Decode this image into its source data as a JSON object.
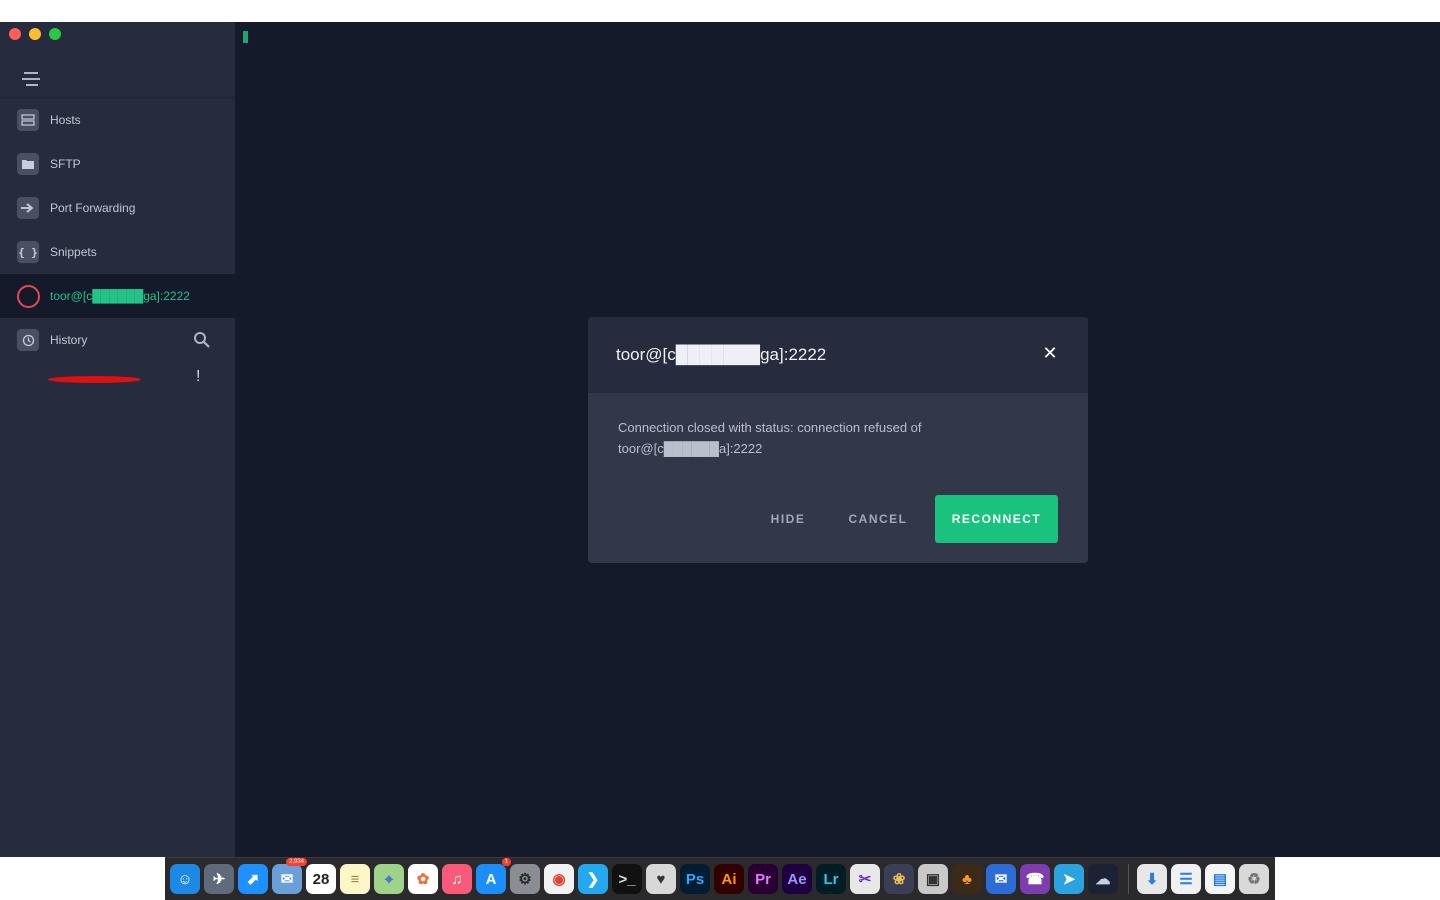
{
  "sidebar": {
    "items": [
      {
        "label": "Hosts",
        "icon": "hosts-icon"
      },
      {
        "label": "SFTP",
        "icon": "folder-icon"
      },
      {
        "label": "Port Forwarding",
        "icon": "port-forwarding-icon"
      },
      {
        "label": "Snippets",
        "icon": "snippets-icon"
      }
    ],
    "active_session": {
      "label": "toor@[c██████ga]:2222",
      "status_color": "#e5484d",
      "label_color": "#23c387"
    },
    "history": {
      "label": "History",
      "item_alert": "!"
    }
  },
  "modal": {
    "title": "toor@[c███████ga]:2222",
    "message_line1": "Connection closed with status: connection refused of",
    "message_line2": "toor@[c██████a]:2222",
    "hide_label": "HIDE",
    "cancel_label": "CANCEL",
    "reconnect_label": "RECONNECT",
    "accent_color": "#19c37d"
  },
  "dock": {
    "apps": [
      {
        "name": "finder-icon",
        "glyph": "☺",
        "bg": "#1e88e5",
        "fg": "#ffffff"
      },
      {
        "name": "launchpad-icon",
        "glyph": "✈",
        "bg": "#5f6b7a",
        "fg": "#ffffff"
      },
      {
        "name": "safari-icon",
        "glyph": "⬈",
        "bg": "#1e90ff",
        "fg": "#ffffff"
      },
      {
        "name": "mail-stamp-icon",
        "glyph": "✉",
        "bg": "#6a9fd8",
        "fg": "#ffffff",
        "badge": "2,934"
      },
      {
        "name": "calendar-icon",
        "glyph": "28",
        "bg": "#ffffff",
        "fg": "#222222"
      },
      {
        "name": "notes-icon",
        "glyph": "≡",
        "bg": "#fff6c8",
        "fg": "#9a8a40"
      },
      {
        "name": "maps-icon",
        "glyph": "⌖",
        "bg": "#9fd38a",
        "fg": "#3a6bd8"
      },
      {
        "name": "photos-icon",
        "glyph": "✿",
        "bg": "#ffffff",
        "fg": "#e8743b"
      },
      {
        "name": "music-icon",
        "glyph": "♫",
        "bg": "#fa5a7a",
        "fg": "#ffffff"
      },
      {
        "name": "app-store-icon",
        "glyph": "A",
        "bg": "#1c8ef9",
        "fg": "#ffffff",
        "badge": "1"
      },
      {
        "name": "system-preferences-icon",
        "glyph": "⚙",
        "bg": "#8a8d93",
        "fg": "#2b2b2b"
      },
      {
        "name": "chrome-icon",
        "glyph": "◉",
        "bg": "#f2f2f2",
        "fg": "#db4437"
      },
      {
        "name": "vscode-icon",
        "glyph": "❯",
        "bg": "#23a9f2",
        "fg": "#ffffff"
      },
      {
        "name": "terminal-icon",
        "glyph": ">_",
        "bg": "#111111",
        "fg": "#dddddd"
      },
      {
        "name": "sequel-pro-icon",
        "glyph": "♥",
        "bg": "#d8d8d8",
        "fg": "#333333"
      },
      {
        "name": "photoshop-icon",
        "glyph": "Ps",
        "bg": "#001d34",
        "fg": "#31a8ff"
      },
      {
        "name": "illustrator-icon",
        "glyph": "Ai",
        "bg": "#330000",
        "fg": "#ff9a00"
      },
      {
        "name": "premiere-icon",
        "glyph": "Pr",
        "bg": "#2a0033",
        "fg": "#e77bff"
      },
      {
        "name": "after-effects-icon",
        "glyph": "Ae",
        "bg": "#1f0041",
        "fg": "#9999ff"
      },
      {
        "name": "lightroom-icon",
        "glyph": "Lr",
        "bg": "#001d26",
        "fg": "#31c5f0"
      },
      {
        "name": "final-cut-icon",
        "glyph": "✂",
        "bg": "#e8e8e8",
        "fg": "#6a2ad8"
      },
      {
        "name": "davinci-icon",
        "glyph": "❀",
        "bg": "#3a3f55",
        "fg": "#f2c14e"
      },
      {
        "name": "compressor-icon",
        "glyph": "▣",
        "bg": "#c9c9c9",
        "fg": "#333333"
      },
      {
        "name": "fl-studio-icon",
        "glyph": "♣",
        "bg": "#3b2a18",
        "fg": "#ff9a1f"
      },
      {
        "name": "airmail-icon",
        "glyph": "✉",
        "bg": "#2b6cd6",
        "fg": "#ffffff"
      },
      {
        "name": "viber-icon",
        "glyph": "☎",
        "bg": "#7d3daf",
        "fg": "#ffffff"
      },
      {
        "name": "telegram-icon",
        "glyph": "➤",
        "bg": "#2aa3e0",
        "fg": "#ffffff"
      },
      {
        "name": "termius-icon",
        "glyph": "☁",
        "bg": "#1c2236",
        "fg": "#c8d0e0"
      }
    ],
    "folders": [
      {
        "name": "downloads-stack-icon",
        "glyph": "⬇",
        "bg": "#e8e8e8",
        "fg": "#2a7de1"
      },
      {
        "name": "documents-stack-icon",
        "glyph": "☰",
        "bg": "#f0f0f0",
        "fg": "#2a7de1"
      },
      {
        "name": "screenshots-stack-icon",
        "glyph": "▤",
        "bg": "#f5f5f5",
        "fg": "#2a7de1"
      },
      {
        "name": "trash-icon",
        "glyph": "♻",
        "bg": "#d9d9d9",
        "fg": "#777777"
      }
    ]
  }
}
